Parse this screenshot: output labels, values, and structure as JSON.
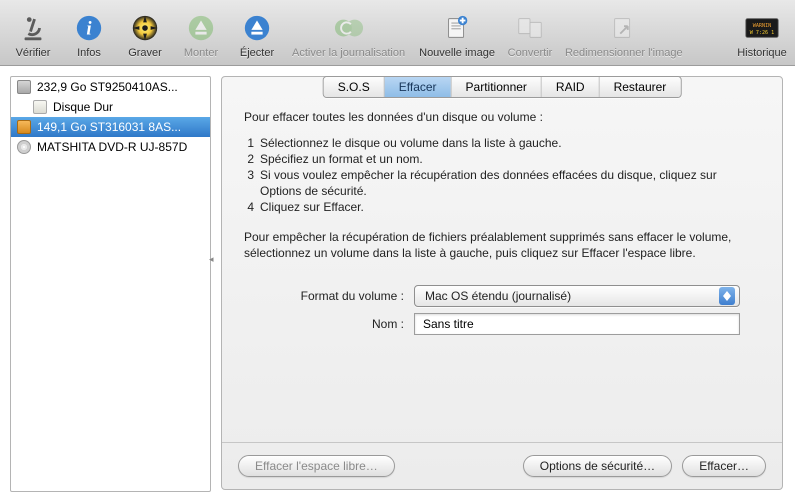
{
  "toolbar": [
    {
      "key": "verify",
      "label": "Vérifier",
      "disabled": false
    },
    {
      "key": "info",
      "label": "Infos",
      "disabled": false
    },
    {
      "key": "burn",
      "label": "Graver",
      "disabled": false
    },
    {
      "key": "mount",
      "label": "Monter",
      "disabled": true
    },
    {
      "key": "eject",
      "label": "Éjecter",
      "disabled": false
    },
    {
      "key": "journal",
      "label": "Activer la journalisation",
      "disabled": true
    },
    {
      "key": "newimage",
      "label": "Nouvelle image",
      "disabled": false
    },
    {
      "key": "convert",
      "label": "Convertir",
      "disabled": true
    },
    {
      "key": "resize",
      "label": "Redimensionner l'image",
      "disabled": true
    },
    {
      "key": "log",
      "label": "Historique",
      "disabled": false
    }
  ],
  "sidebar": {
    "items": [
      {
        "label": "232,9 Go ST9250410AS...",
        "icon": "hdd",
        "indent": false,
        "selected": false
      },
      {
        "label": "Disque Dur",
        "icon": "vol",
        "indent": true,
        "selected": false
      },
      {
        "label": "149,1 Go ST316031 8AS...",
        "icon": "orange",
        "indent": false,
        "selected": true
      },
      {
        "label": "MATSHITA DVD-R UJ-857D",
        "icon": "cd",
        "indent": false,
        "selected": false
      }
    ]
  },
  "tabs": [
    {
      "label": "S.O.S",
      "active": false
    },
    {
      "label": "Effacer",
      "active": true
    },
    {
      "label": "Partitionner",
      "active": false
    },
    {
      "label": "RAID",
      "active": false
    },
    {
      "label": "Restaurer",
      "active": false
    }
  ],
  "erase": {
    "intro": "Pour effacer toutes les données d'un disque ou volume :",
    "steps": [
      "Sélectionnez le disque ou volume dans la liste à gauche.",
      "Spécifiez un format et un nom.",
      "Si vous voulez empêcher la récupération des données effacées du disque, cliquez sur Options de sécurité.",
      "Cliquez sur Effacer."
    ],
    "note": "Pour empêcher la récupération de fichiers préalablement supprimés sans effacer le volume, sélectionnez un volume dans la liste à gauche, puis cliquez sur Effacer l'espace libre.",
    "format_label": "Format du volume :",
    "format_value": "Mac OS étendu (journalisé)",
    "name_label": "Nom :",
    "name_value": "Sans titre"
  },
  "buttons": {
    "erase_free": "Effacer l'espace libre…",
    "security": "Options de sécurité…",
    "erase": "Effacer…"
  }
}
